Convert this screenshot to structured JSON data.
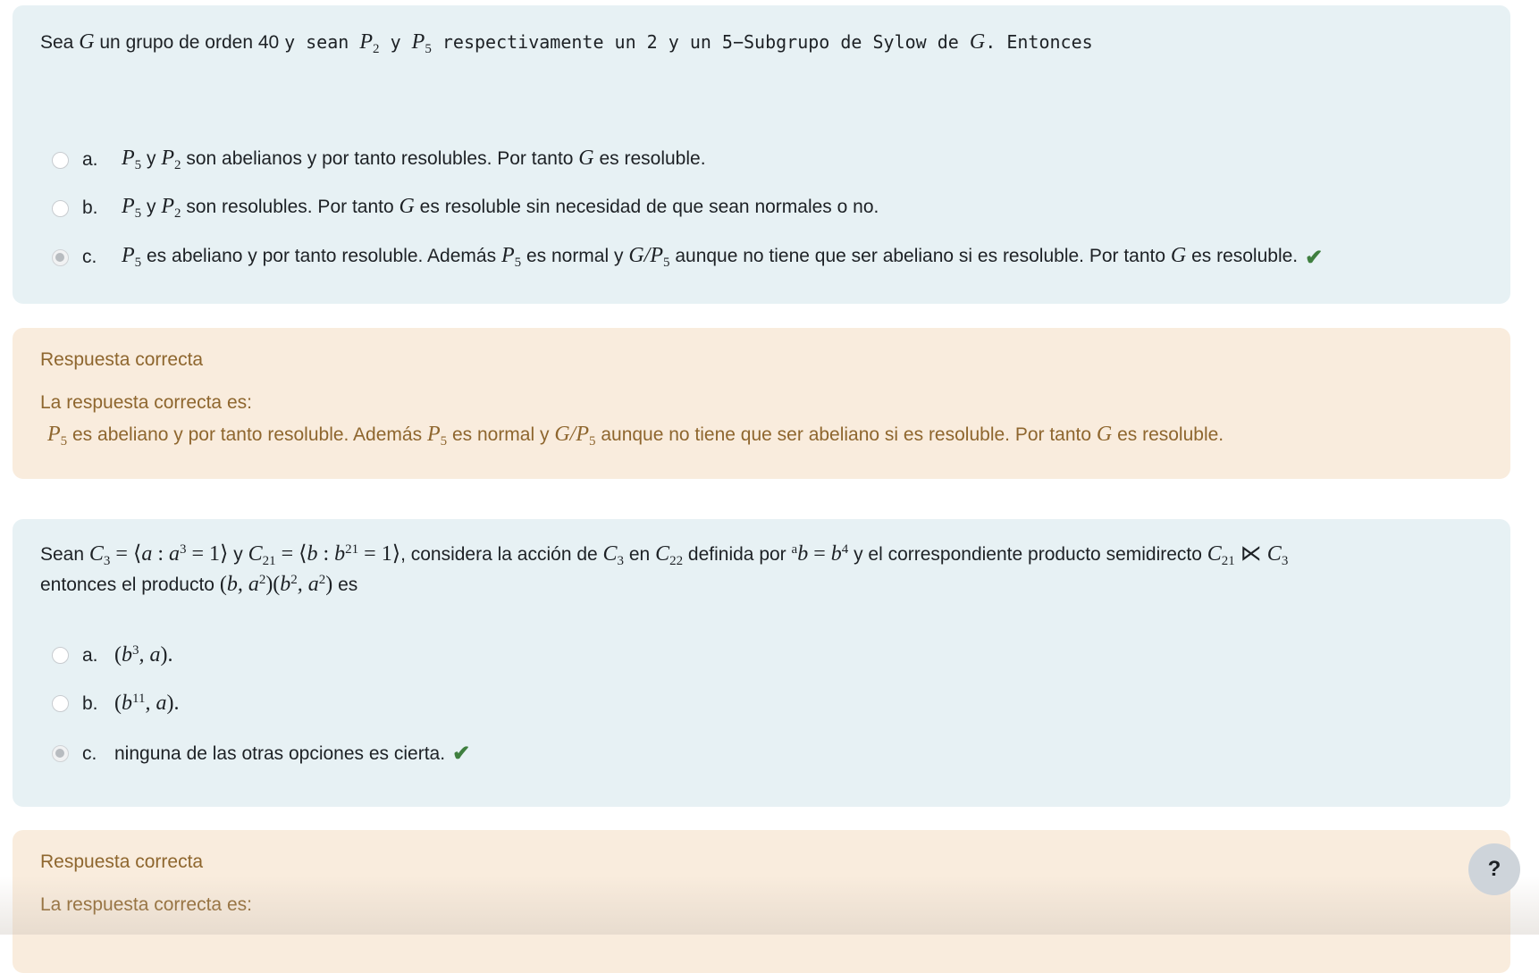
{
  "questions": [
    {
      "text_lines": [
        [
          {
            "k": "t",
            "t": "Sea "
          },
          {
            "k": "m",
            "t": "G"
          },
          {
            "k": "t",
            "t": " un grupo de orden 40 "
          },
          {
            "k": "mono",
            "t": "y sean "
          },
          {
            "k": "m",
            "t": "P"
          },
          {
            "k": "sub",
            "t": "2"
          },
          {
            "k": "mono",
            "t": " y "
          },
          {
            "k": "m",
            "t": "P"
          },
          {
            "k": "sub",
            "t": "5"
          },
          {
            "k": "mono",
            "t": " respectivamente un 2 y un 5−Subgrupo de Sylow de "
          },
          {
            "k": "m",
            "t": "G"
          },
          {
            "k": "mono",
            "t": ". Entonces"
          }
        ]
      ],
      "options": [
        {
          "letter": "a.",
          "selected": false,
          "correct": false,
          "segs": [
            {
              "k": "m",
              "t": "P"
            },
            {
              "k": "sub",
              "t": "5"
            },
            {
              "k": "t",
              "t": " y "
            },
            {
              "k": "m",
              "t": "P"
            },
            {
              "k": "sub",
              "t": "2"
            },
            {
              "k": "t",
              "t": " son abelianos y por tanto resolubles. Por tanto "
            },
            {
              "k": "m",
              "t": "G"
            },
            {
              "k": "t",
              "t": " es resoluble."
            }
          ]
        },
        {
          "letter": "b.",
          "selected": false,
          "correct": false,
          "segs": [
            {
              "k": "m",
              "t": "P"
            },
            {
              "k": "sub",
              "t": "5"
            },
            {
              "k": "t",
              "t": " y "
            },
            {
              "k": "m",
              "t": "P"
            },
            {
              "k": "sub",
              "t": "2"
            },
            {
              "k": "t",
              "t": " son resolubles. Por tanto "
            },
            {
              "k": "m",
              "t": "G"
            },
            {
              "k": "t",
              "t": " es resoluble sin necesidad de que sean normales o no."
            }
          ]
        },
        {
          "letter": "c.",
          "selected": true,
          "correct": true,
          "segs": [
            {
              "k": "m",
              "t": "P"
            },
            {
              "k": "sub",
              "t": "5"
            },
            {
              "k": "t",
              "t": " es abeliano y por tanto resoluble. Además "
            },
            {
              "k": "m",
              "t": "P"
            },
            {
              "k": "sub",
              "t": "5"
            },
            {
              "k": "t",
              "t": " es normal y "
            },
            {
              "k": "m",
              "t": "G/P"
            },
            {
              "k": "sub",
              "t": "5"
            },
            {
              "k": "t",
              "t": " aunque no tiene que ser abeliano si es resoluble. Por tanto "
            },
            {
              "k": "m",
              "t": "G"
            },
            {
              "k": "t",
              "t": " es resoluble."
            }
          ]
        }
      ],
      "feedback": {
        "status": "Respuesta correcta",
        "intro": "La respuesta correcta es:",
        "answer": [
          {
            "k": "m",
            "t": "P"
          },
          {
            "k": "sub",
            "t": "5"
          },
          {
            "k": "t",
            "t": " es abeliano y por tanto resoluble. Además "
          },
          {
            "k": "m",
            "t": "P"
          },
          {
            "k": "sub",
            "t": "5"
          },
          {
            "k": "t",
            "t": " es normal y "
          },
          {
            "k": "m",
            "t": "G/P"
          },
          {
            "k": "sub",
            "t": "5"
          },
          {
            "k": "t",
            "t": " aunque no tiene que ser abeliano si es resoluble. Por tanto "
          },
          {
            "k": "m",
            "t": "G"
          },
          {
            "k": "t",
            "t": " es resoluble."
          }
        ]
      }
    },
    {
      "text_lines": [
        [
          {
            "k": "t",
            "t": "Sean "
          },
          {
            "k": "m",
            "t": "C"
          },
          {
            "k": "sub",
            "t": "3"
          },
          {
            "k": "mr",
            "t": " = ⟨"
          },
          {
            "k": "m",
            "t": "a"
          },
          {
            "k": "mr",
            "t": " : "
          },
          {
            "k": "m",
            "t": "a"
          },
          {
            "k": "sup",
            "t": "3"
          },
          {
            "k": "mr",
            "t": " = 1⟩"
          },
          {
            "k": "t",
            "t": " y "
          },
          {
            "k": "m",
            "t": "C"
          },
          {
            "k": "sub",
            "t": "21"
          },
          {
            "k": "mr",
            "t": " = ⟨"
          },
          {
            "k": "m",
            "t": "b"
          },
          {
            "k": "mr",
            "t": " : "
          },
          {
            "k": "m",
            "t": "b"
          },
          {
            "k": "sup",
            "t": "21"
          },
          {
            "k": "mr",
            "t": " = 1⟩"
          },
          {
            "k": "t",
            "t": ", considera la acción de "
          },
          {
            "k": "m",
            "t": "C"
          },
          {
            "k": "sub",
            "t": "3"
          },
          {
            "k": "t",
            "t": " en "
          },
          {
            "k": "m",
            "t": "C"
          },
          {
            "k": "sub",
            "t": "22"
          },
          {
            "k": "t",
            "t": " definida por "
          },
          {
            "k": "sup",
            "t": "a"
          },
          {
            "k": "m",
            "t": "b"
          },
          {
            "k": "mr",
            "t": " = "
          },
          {
            "k": "m",
            "t": "b"
          },
          {
            "k": "sup",
            "t": "4"
          },
          {
            "k": "t",
            "t": " y el correspondiente producto semidirecto "
          },
          {
            "k": "m",
            "t": "C"
          },
          {
            "k": "sub",
            "t": "21"
          },
          {
            "k": "mr",
            "t": " ⋉ "
          },
          {
            "k": "m",
            "t": "C"
          },
          {
            "k": "sub",
            "t": "3"
          }
        ],
        [
          {
            "k": "t",
            "t": "entonces el producto "
          },
          {
            "k": "mr",
            "t": "("
          },
          {
            "k": "m",
            "t": "b, a"
          },
          {
            "k": "sup",
            "t": "2"
          },
          {
            "k": "mr",
            "t": ")("
          },
          {
            "k": "m",
            "t": "b"
          },
          {
            "k": "sup",
            "t": "2"
          },
          {
            "k": "m",
            "t": ", a"
          },
          {
            "k": "sup",
            "t": "2"
          },
          {
            "k": "mr",
            "t": ")"
          },
          {
            "k": "t",
            "t": " es"
          }
        ]
      ],
      "options": [
        {
          "letter": "a.",
          "selected": false,
          "correct": false,
          "segs": [
            {
              "k": "mr",
              "t": "("
            },
            {
              "k": "m",
              "t": "b"
            },
            {
              "k": "sup",
              "t": "3"
            },
            {
              "k": "m",
              "t": ", a"
            },
            {
              "k": "mr",
              "t": ")."
            }
          ]
        },
        {
          "letter": "b.",
          "selected": false,
          "correct": false,
          "segs": [
            {
              "k": "mr",
              "t": "("
            },
            {
              "k": "m",
              "t": "b"
            },
            {
              "k": "sup",
              "t": "11"
            },
            {
              "k": "m",
              "t": ", a"
            },
            {
              "k": "mr",
              "t": ")."
            }
          ]
        },
        {
          "letter": "c.",
          "selected": true,
          "correct": true,
          "segs": [
            {
              "k": "t",
              "t": "ninguna de las otras opciones es cierta."
            }
          ]
        }
      ],
      "feedback": {
        "status": "Respuesta correcta",
        "intro": "La respuesta correcta es:"
      }
    }
  ],
  "icons": {
    "check": "✔",
    "help": "?"
  },
  "colors": {
    "question_bg": "#e7f1f4",
    "feedback_bg": "#f9ecdd",
    "feedback_text": "#8e662e",
    "check": "#3f7f3f"
  }
}
